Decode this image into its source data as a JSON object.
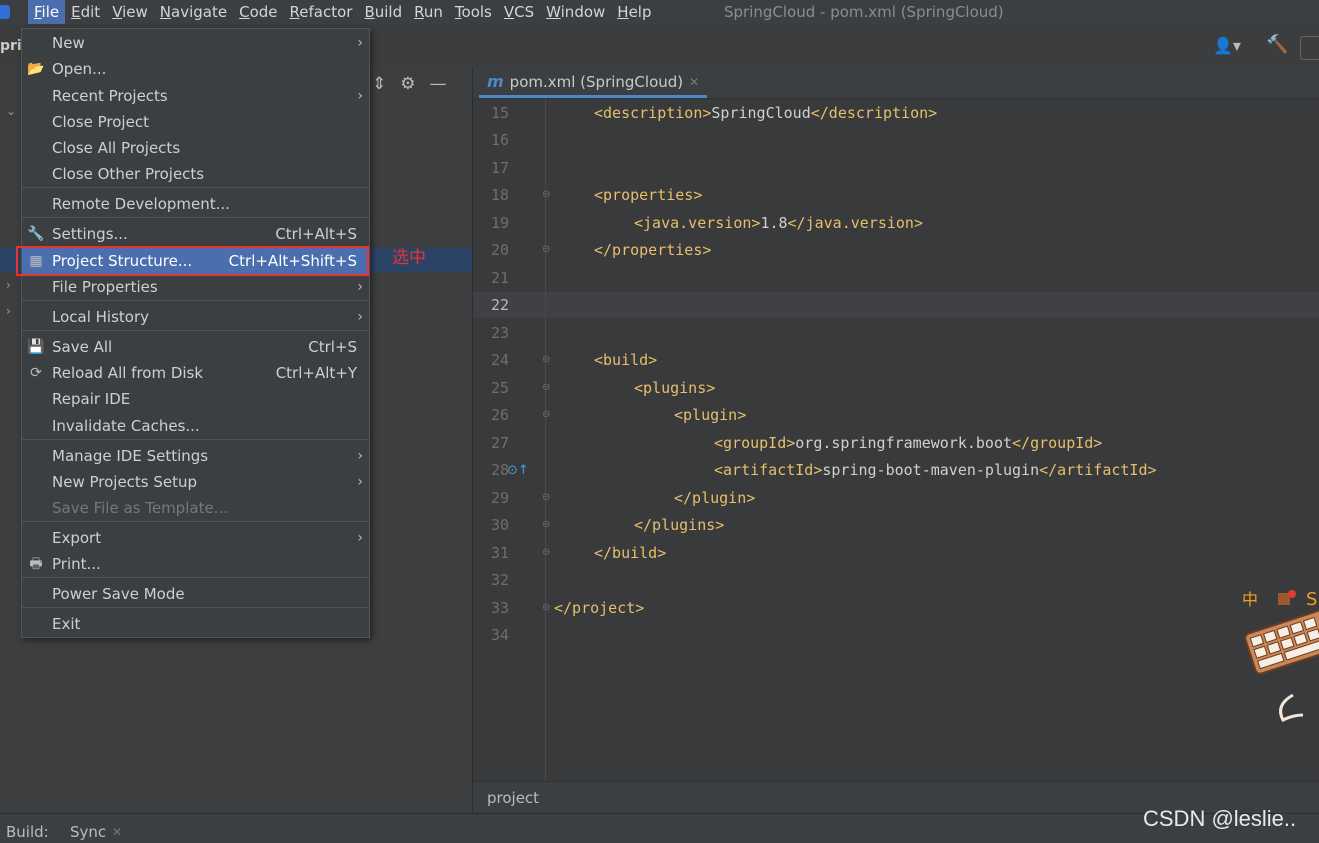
{
  "window_title": "SpringCloud - pom.xml (SpringCloud)",
  "menubar": [
    "File",
    "Edit",
    "View",
    "Navigate",
    "Code",
    "Refactor",
    "Build",
    "Run",
    "Tools",
    "VCS",
    "Window",
    "Help"
  ],
  "project_label": "prin",
  "editor_tab": {
    "icon": "m",
    "label": "pom.xml (SpringCloud)"
  },
  "breadcrumb": "project",
  "bottom": {
    "build": "Build:",
    "sync": "Sync"
  },
  "watermark": "CSDN @leslie..",
  "annotation": "选中",
  "file_menu": {
    "new": "New",
    "open": "Open...",
    "recent": "Recent Projects",
    "close_project": "Close Project",
    "close_all": "Close All Projects",
    "close_other": "Close Other Projects",
    "remote": "Remote Development...",
    "settings": "Settings...",
    "settings_sc": "Ctrl+Alt+S",
    "project_structure": "Project Structure...",
    "project_structure_sc": "Ctrl+Alt+Shift+S",
    "file_properties": "File Properties",
    "local_history": "Local History",
    "save_all": "Save All",
    "save_all_sc": "Ctrl+S",
    "reload": "Reload All from Disk",
    "reload_sc": "Ctrl+Alt+Y",
    "repair": "Repair IDE",
    "invalidate": "Invalidate Caches...",
    "manage": "Manage IDE Settings",
    "new_setup": "New Projects Setup",
    "save_template": "Save File as Template...",
    "export": "Export",
    "print": "Print...",
    "power_save": "Power Save Mode",
    "exit": "Exit"
  },
  "code": {
    "line_numbers": [
      "15",
      "16",
      "17",
      "18",
      "19",
      "20",
      "21",
      "22",
      "23",
      "24",
      "25",
      "26",
      "27",
      "28",
      "29",
      "30",
      "31",
      "32",
      "33",
      "34"
    ],
    "l15_open": "<description>",
    "l15_text": "SpringCloud",
    "l15_close": "</description>",
    "l18": "<properties>",
    "l19_open": "<java.version>",
    "l19_text": "1.8",
    "l19_close": "</java.version>",
    "l20": "</properties>",
    "l24": "<build>",
    "l25": "<plugins>",
    "l26": "<plugin>",
    "l27_open": "<groupId>",
    "l27_text": "org.springframework.boot",
    "l27_close": "</groupId>",
    "l28_open": "<artifactId>",
    "l28_text": "spring-boot-maven-plugin",
    "l28_close": "</artifactId>",
    "l29": "</plugin>",
    "l30": "</plugins>",
    "l31": "</build>",
    "l33": "</project>"
  }
}
